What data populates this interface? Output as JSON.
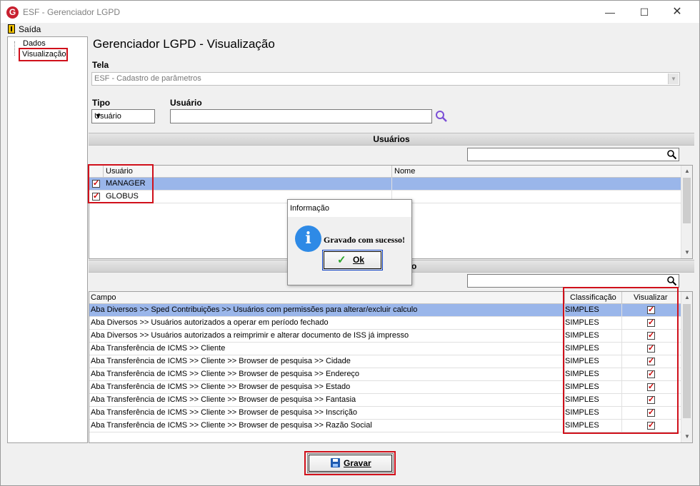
{
  "window": {
    "title": "ESF - Gerenciador LGPD",
    "app_icon": "G",
    "minimize": "—",
    "maximize": "☐",
    "close": "✕"
  },
  "menu": {
    "exit_label": "Saída"
  },
  "tree": {
    "items": [
      {
        "label": "Dados"
      },
      {
        "label": "Visualização"
      }
    ]
  },
  "page": {
    "title": "Gerenciador LGPD - Visualização"
  },
  "form": {
    "tela_label": "Tela",
    "tela_value": "ESF - Cadastro de parâmetros",
    "tipo_label": "Tipo",
    "tipo_value": "Usuário",
    "usuario_label": "Usuário",
    "usuario_value": ""
  },
  "users_section": {
    "header": "Usuários",
    "filter_value": "",
    "columns": [
      "Usuário",
      "Nome"
    ],
    "rows": [
      {
        "usuario": "MANAGER",
        "nome": "",
        "checked": true,
        "selected": true
      },
      {
        "usuario": "GLOBUS",
        "nome": "",
        "checked": true,
        "selected": false
      }
    ]
  },
  "fields_section": {
    "header_visible_suffix": "o",
    "filter_value": "",
    "columns": [
      "Campo",
      "Classificação",
      "Visualizar"
    ],
    "rows": [
      {
        "campo": "Aba Diversos >> Sped Contribuições >> Usuários com permissões para alterar/excluir calculo",
        "classificacao": "SIMPLES",
        "visualizar": true
      },
      {
        "campo": "Aba Diversos >> Usuários autorizados a operar em período fechado",
        "classificacao": "SIMPLES",
        "visualizar": true
      },
      {
        "campo": "Aba Diversos >> Usuários autorizados a reimprimir e alterar documento de ISS já impresso",
        "classificacao": "SIMPLES",
        "visualizar": true
      },
      {
        "campo": "Aba Transferência de ICMS >> Cliente",
        "classificacao": "SIMPLES",
        "visualizar": true
      },
      {
        "campo": "Aba Transferência de ICMS >> Cliente >> Browser de pesquisa >> Cidade",
        "classificacao": "SIMPLES",
        "visualizar": true
      },
      {
        "campo": "Aba Transferência de ICMS >> Cliente >> Browser de pesquisa >> Endereço",
        "classificacao": "SIMPLES",
        "visualizar": true
      },
      {
        "campo": "Aba Transferência de ICMS >> Cliente >> Browser de pesquisa >> Estado",
        "classificacao": "SIMPLES",
        "visualizar": true
      },
      {
        "campo": "Aba Transferência de ICMS >> Cliente >> Browser de pesquisa >> Fantasia",
        "classificacao": "SIMPLES",
        "visualizar": true
      },
      {
        "campo": "Aba Transferência de ICMS >> Cliente >> Browser de pesquisa >> Inscrição",
        "classificacao": "SIMPLES",
        "visualizar": true
      },
      {
        "campo": "Aba Transferência de ICMS >> Cliente >> Browser de pesquisa >> Razão Social",
        "classificacao": "SIMPLES",
        "visualizar": true
      }
    ]
  },
  "dialog": {
    "title": "Informação",
    "icon": "i",
    "message": "Gravado com sucesso!",
    "ok_label": "Ok"
  },
  "footer": {
    "save_label": "Gravar"
  },
  "colors": {
    "highlight": "#d0101b",
    "selected_row": "#9ab6ea",
    "info_icon": "#2e8ae6"
  }
}
